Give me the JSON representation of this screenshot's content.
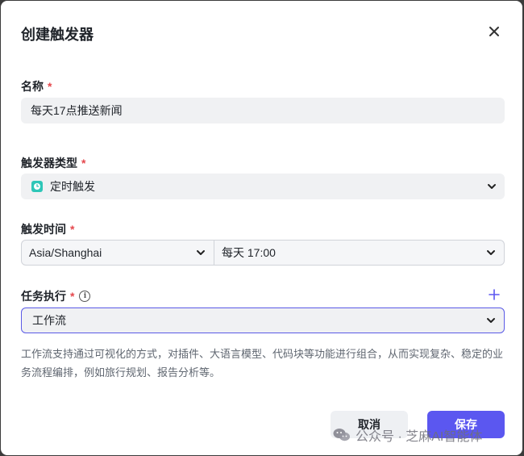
{
  "dialog": {
    "title": "创建触发器"
  },
  "name_field": {
    "label": "名称",
    "required_mark": "*",
    "value": "每天17点推送新闻"
  },
  "trigger_type": {
    "label": "触发器类型",
    "required_mark": "*",
    "value": "定时触发",
    "icon": "clock-icon"
  },
  "trigger_time": {
    "label": "触发时间",
    "required_mark": "*",
    "timezone": "Asia/Shanghai",
    "schedule": "每天 17:00"
  },
  "task": {
    "label": "任务执行",
    "required_mark": "*",
    "info_glyph": "i",
    "value": "工作流",
    "description": "工作流支持通过可视化的方式，对插件、大语言模型、代码块等功能进行组合，从而实现复杂、稳定的业务流程编排，例如旅行规划、报告分析等。"
  },
  "footer": {
    "cancel_label": "取消",
    "save_label": "保存"
  },
  "watermark": {
    "text": "公众号 · 芝麻AI智能体"
  },
  "colors": {
    "accent": "#5b57f0",
    "required": "#e5484d",
    "type_icon": "#2ec6b8"
  }
}
